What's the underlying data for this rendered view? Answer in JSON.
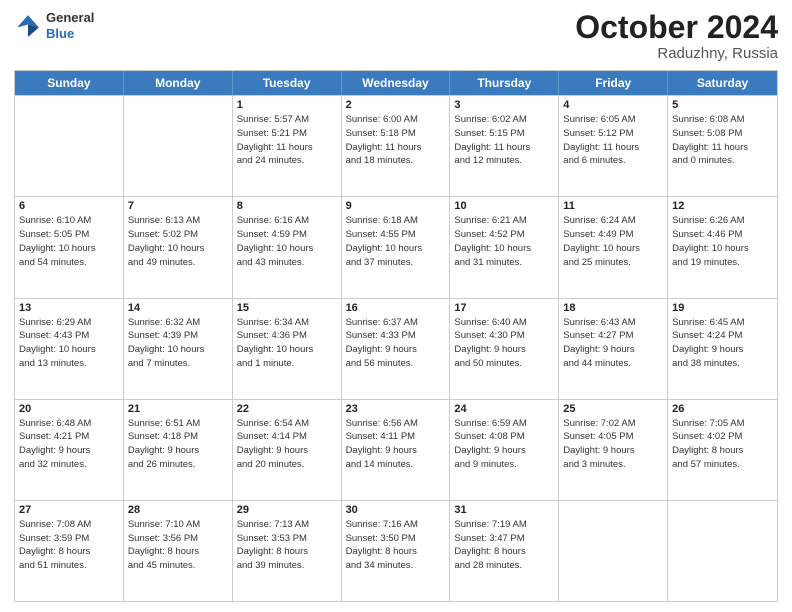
{
  "header": {
    "logo": {
      "general": "General",
      "blue": "Blue"
    },
    "month_year": "October 2024",
    "location": "Raduzhny, Russia"
  },
  "weekdays": [
    "Sunday",
    "Monday",
    "Tuesday",
    "Wednesday",
    "Thursday",
    "Friday",
    "Saturday"
  ],
  "weeks": [
    [
      {
        "day": "",
        "lines": []
      },
      {
        "day": "",
        "lines": []
      },
      {
        "day": "1",
        "lines": [
          "Sunrise: 5:57 AM",
          "Sunset: 5:21 PM",
          "Daylight: 11 hours",
          "and 24 minutes."
        ]
      },
      {
        "day": "2",
        "lines": [
          "Sunrise: 6:00 AM",
          "Sunset: 5:18 PM",
          "Daylight: 11 hours",
          "and 18 minutes."
        ]
      },
      {
        "day": "3",
        "lines": [
          "Sunrise: 6:02 AM",
          "Sunset: 5:15 PM",
          "Daylight: 11 hours",
          "and 12 minutes."
        ]
      },
      {
        "day": "4",
        "lines": [
          "Sunrise: 6:05 AM",
          "Sunset: 5:12 PM",
          "Daylight: 11 hours",
          "and 6 minutes."
        ]
      },
      {
        "day": "5",
        "lines": [
          "Sunrise: 6:08 AM",
          "Sunset: 5:08 PM",
          "Daylight: 11 hours",
          "and 0 minutes."
        ]
      }
    ],
    [
      {
        "day": "6",
        "lines": [
          "Sunrise: 6:10 AM",
          "Sunset: 5:05 PM",
          "Daylight: 10 hours",
          "and 54 minutes."
        ]
      },
      {
        "day": "7",
        "lines": [
          "Sunrise: 6:13 AM",
          "Sunset: 5:02 PM",
          "Daylight: 10 hours",
          "and 49 minutes."
        ]
      },
      {
        "day": "8",
        "lines": [
          "Sunrise: 6:16 AM",
          "Sunset: 4:59 PM",
          "Daylight: 10 hours",
          "and 43 minutes."
        ]
      },
      {
        "day": "9",
        "lines": [
          "Sunrise: 6:18 AM",
          "Sunset: 4:55 PM",
          "Daylight: 10 hours",
          "and 37 minutes."
        ]
      },
      {
        "day": "10",
        "lines": [
          "Sunrise: 6:21 AM",
          "Sunset: 4:52 PM",
          "Daylight: 10 hours",
          "and 31 minutes."
        ]
      },
      {
        "day": "11",
        "lines": [
          "Sunrise: 6:24 AM",
          "Sunset: 4:49 PM",
          "Daylight: 10 hours",
          "and 25 minutes."
        ]
      },
      {
        "day": "12",
        "lines": [
          "Sunrise: 6:26 AM",
          "Sunset: 4:46 PM",
          "Daylight: 10 hours",
          "and 19 minutes."
        ]
      }
    ],
    [
      {
        "day": "13",
        "lines": [
          "Sunrise: 6:29 AM",
          "Sunset: 4:43 PM",
          "Daylight: 10 hours",
          "and 13 minutes."
        ]
      },
      {
        "day": "14",
        "lines": [
          "Sunrise: 6:32 AM",
          "Sunset: 4:39 PM",
          "Daylight: 10 hours",
          "and 7 minutes."
        ]
      },
      {
        "day": "15",
        "lines": [
          "Sunrise: 6:34 AM",
          "Sunset: 4:36 PM",
          "Daylight: 10 hours",
          "and 1 minute."
        ]
      },
      {
        "day": "16",
        "lines": [
          "Sunrise: 6:37 AM",
          "Sunset: 4:33 PM",
          "Daylight: 9 hours",
          "and 56 minutes."
        ]
      },
      {
        "day": "17",
        "lines": [
          "Sunrise: 6:40 AM",
          "Sunset: 4:30 PM",
          "Daylight: 9 hours",
          "and 50 minutes."
        ]
      },
      {
        "day": "18",
        "lines": [
          "Sunrise: 6:43 AM",
          "Sunset: 4:27 PM",
          "Daylight: 9 hours",
          "and 44 minutes."
        ]
      },
      {
        "day": "19",
        "lines": [
          "Sunrise: 6:45 AM",
          "Sunset: 4:24 PM",
          "Daylight: 9 hours",
          "and 38 minutes."
        ]
      }
    ],
    [
      {
        "day": "20",
        "lines": [
          "Sunrise: 6:48 AM",
          "Sunset: 4:21 PM",
          "Daylight: 9 hours",
          "and 32 minutes."
        ]
      },
      {
        "day": "21",
        "lines": [
          "Sunrise: 6:51 AM",
          "Sunset: 4:18 PM",
          "Daylight: 9 hours",
          "and 26 minutes."
        ]
      },
      {
        "day": "22",
        "lines": [
          "Sunrise: 6:54 AM",
          "Sunset: 4:14 PM",
          "Daylight: 9 hours",
          "and 20 minutes."
        ]
      },
      {
        "day": "23",
        "lines": [
          "Sunrise: 6:56 AM",
          "Sunset: 4:11 PM",
          "Daylight: 9 hours",
          "and 14 minutes."
        ]
      },
      {
        "day": "24",
        "lines": [
          "Sunrise: 6:59 AM",
          "Sunset: 4:08 PM",
          "Daylight: 9 hours",
          "and 9 minutes."
        ]
      },
      {
        "day": "25",
        "lines": [
          "Sunrise: 7:02 AM",
          "Sunset: 4:05 PM",
          "Daylight: 9 hours",
          "and 3 minutes."
        ]
      },
      {
        "day": "26",
        "lines": [
          "Sunrise: 7:05 AM",
          "Sunset: 4:02 PM",
          "Daylight: 8 hours",
          "and 57 minutes."
        ]
      }
    ],
    [
      {
        "day": "27",
        "lines": [
          "Sunrise: 7:08 AM",
          "Sunset: 3:59 PM",
          "Daylight: 8 hours",
          "and 51 minutes."
        ]
      },
      {
        "day": "28",
        "lines": [
          "Sunrise: 7:10 AM",
          "Sunset: 3:56 PM",
          "Daylight: 8 hours",
          "and 45 minutes."
        ]
      },
      {
        "day": "29",
        "lines": [
          "Sunrise: 7:13 AM",
          "Sunset: 3:53 PM",
          "Daylight: 8 hours",
          "and 39 minutes."
        ]
      },
      {
        "day": "30",
        "lines": [
          "Sunrise: 7:16 AM",
          "Sunset: 3:50 PM",
          "Daylight: 8 hours",
          "and 34 minutes."
        ]
      },
      {
        "day": "31",
        "lines": [
          "Sunrise: 7:19 AM",
          "Sunset: 3:47 PM",
          "Daylight: 8 hours",
          "and 28 minutes."
        ]
      },
      {
        "day": "",
        "lines": []
      },
      {
        "day": "",
        "lines": []
      }
    ]
  ]
}
